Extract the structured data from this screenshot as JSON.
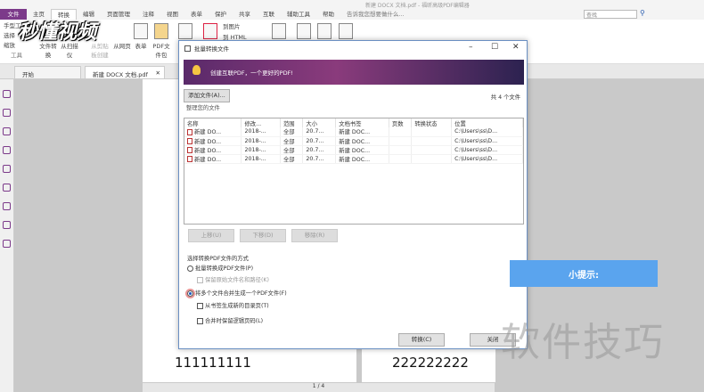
{
  "window": {
    "title": "新建 DOCX 文档.pdf - 福昕高级PDF编辑器"
  },
  "menu": {
    "tabs": [
      "文件",
      "主页",
      "转换",
      "编辑",
      "页面管理",
      "注释",
      "视图",
      "表单",
      "保护",
      "共享",
      "互联",
      "辅助工具",
      "帮助"
    ],
    "tell_me": "告诉我您想要做什么...",
    "search_placeholder": "查找"
  },
  "ribbon": {
    "tools": [
      "手型工具",
      "选择",
      "缩放"
    ],
    "tools_group": "工具",
    "buttons": [
      "文件转换",
      "从扫描仪",
      "从剪贴板创建",
      "从网页",
      "表单",
      "PDF文件包",
      "到图片",
      "到 HTML"
    ]
  },
  "doc_tabs": [
    "开始",
    "新建 DOCX 文档.pdf"
  ],
  "logo": "秒懂视频",
  "document": {
    "page1_text": "111111111",
    "page2_text": "222222222",
    "page_nav": "1 / 4"
  },
  "dialog": {
    "title": "批量转换文件",
    "banner": "创建互联PDF，一个更好的PDF!",
    "add_files": "添加文件(A)...",
    "file_count": "共 4 个文件",
    "section_label": "整理您的文件",
    "columns": [
      "名称",
      "修改...",
      "范围",
      "大小",
      "文档书签",
      "页数",
      "转换状态",
      "位置"
    ],
    "rows": [
      [
        "新建 DO...",
        "2018-...",
        "全部",
        "20.7...",
        "新建 DOC...",
        "",
        "",
        "C:\\Users\\ss\\D..."
      ],
      [
        "新建 DO...",
        "2018-...",
        "全部",
        "20.7...",
        "新建 DOC...",
        "",
        "",
        "C:\\Users\\ss\\D..."
      ],
      [
        "新建 DO...",
        "2018-...",
        "全部",
        "20.7...",
        "新建 DOC...",
        "",
        "",
        "C:\\Users\\ss\\D..."
      ],
      [
        "新建 DO...",
        "2018-...",
        "全部",
        "20.7...",
        "新建 DOC...",
        "",
        "",
        "C:\\Users\\ss\\D..."
      ]
    ],
    "move_up": "上移(U)",
    "move_down": "下移(D)",
    "remove": "移除(R)",
    "method_label": "选择转换PDF文件的方式",
    "option_batch": "批量转换成PDF文件(P)",
    "option_keep_name": "保留原始文件名和路径(K)",
    "option_merge": "将多个文件合并生成一个PDF文件(F)",
    "option_toc": "从书签生成新的目录页(T)",
    "option_logical": "合并时保留逻辑页码(L)",
    "convert": "转换(C)",
    "close": "关闭"
  },
  "overlay": {
    "tip": "小提示:",
    "watermark": "软件技巧"
  }
}
